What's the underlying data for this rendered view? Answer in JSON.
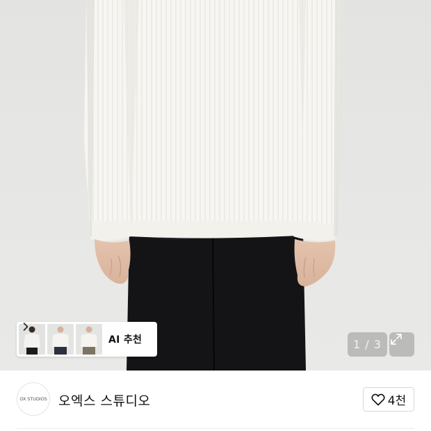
{
  "gallery": {
    "current_page": 1,
    "total_pages": 3,
    "counter_text": "1 / 3",
    "expand_icon": "expand-icon"
  },
  "ai_recommend": {
    "label": "AI 추천",
    "chevron_icon": "chevron-right-icon"
  },
  "brand": {
    "logo_text": "OX STUDIOS",
    "name": "오엑스 스튜디오"
  },
  "like": {
    "icon": "heart-icon",
    "count": "4천"
  },
  "colors": {
    "background": "#e5e5e3",
    "shirt": "#f7f6f2",
    "pants": "#141416",
    "text": "#111111"
  }
}
